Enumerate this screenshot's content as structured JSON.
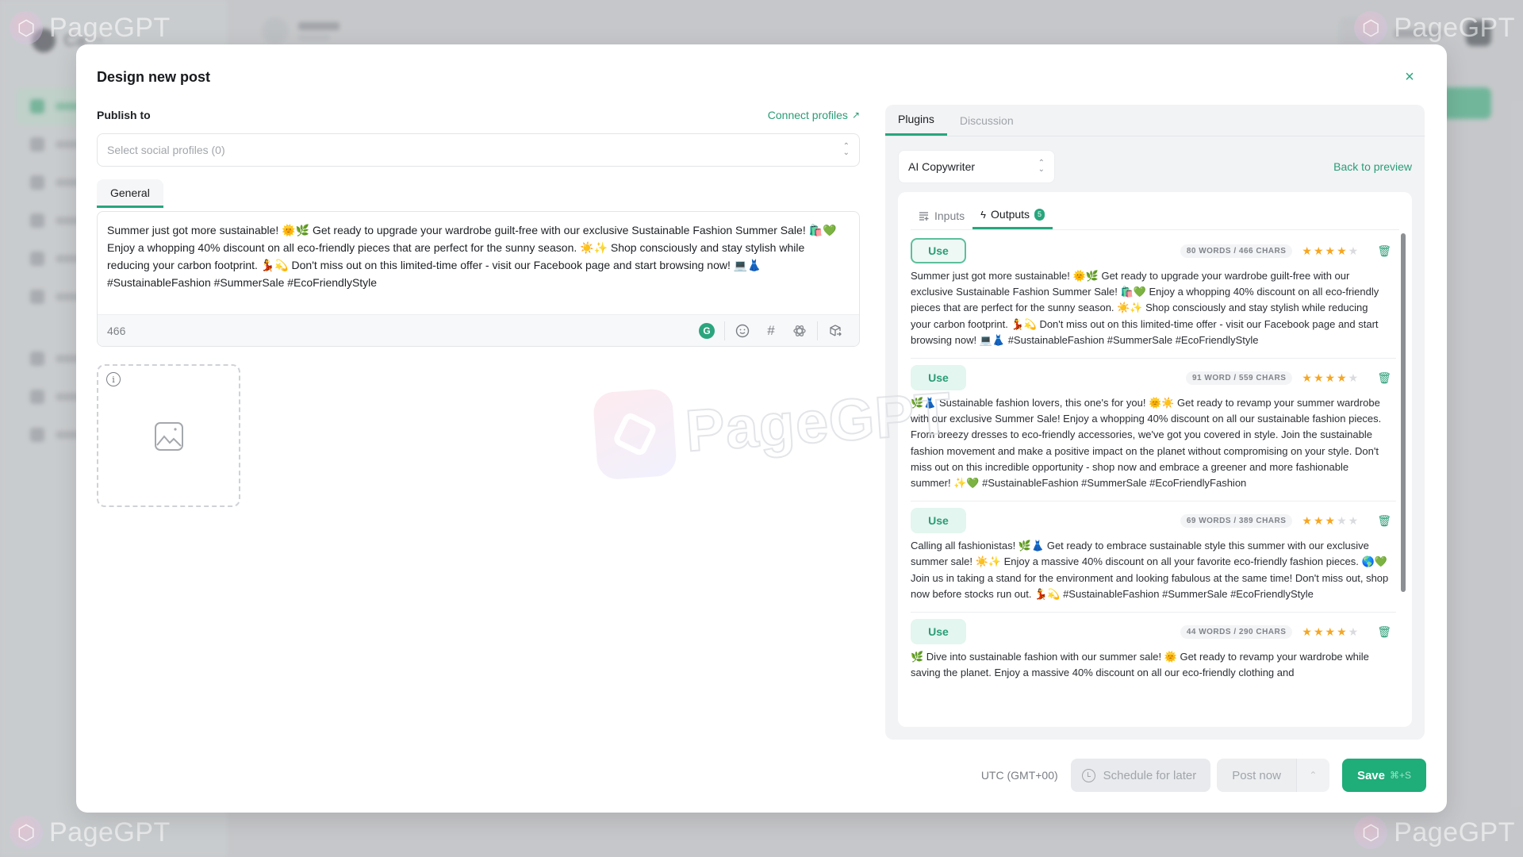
{
  "background": {
    "brand": "PageGPT",
    "workspace": "Personal"
  },
  "modal": {
    "title": "Design new post",
    "close_label": "×"
  },
  "publish": {
    "label": "Publish to",
    "connect_label": "Connect profiles",
    "select_placeholder": "Select social profiles (0)"
  },
  "editor": {
    "tab_label": "General",
    "content": "Summer just got more sustainable! 🌞🌿 Get ready to upgrade your wardrobe guilt-free with our exclusive Sustainable Fashion Summer Sale! 🛍️💚 Enjoy a whopping 40% discount on all eco-friendly pieces that are perfect for the sunny season. ☀️✨ Shop consciously and stay stylish while reducing your carbon footprint. 💃💫 Don't miss out on this limited-time offer - visit our Facebook page and start browsing now! 💻👗 #SustainableFashion #SummerSale #EcoFriendlyStyle",
    "char_count": "466",
    "tools": [
      "grammarly-icon",
      "emoji-icon",
      "hashtag-icon",
      "openai-icon",
      "export-box-icon"
    ]
  },
  "right_panel": {
    "tabs": [
      {
        "label": "Plugins",
        "active": true
      },
      {
        "label": "Discussion",
        "active": false
      }
    ],
    "plugin_selected": "AI Copywriter",
    "back_label": "Back to preview",
    "sub_tabs": [
      {
        "label": "Inputs",
        "active": false
      },
      {
        "label": "Outputs",
        "active": true,
        "badge": "5"
      }
    ],
    "use_label": "Use",
    "outputs": [
      {
        "counts": "80 WORDS / 466 CHARS",
        "rating": 4,
        "text": "Summer just got more sustainable! 🌞🌿 Get ready to upgrade your wardrobe guilt-free with our exclusive Sustainable Fashion Summer Sale! 🛍️💚 Enjoy a whopping 40% discount on all eco-friendly pieces that are perfect for the sunny season. ☀️✨ Shop consciously and stay stylish while reducing your carbon footprint. 💃💫 Don't miss out on this limited-time offer - visit our Facebook page and start browsing now! 💻👗 #SustainableFashion #SummerSale #EcoFriendlyStyle"
      },
      {
        "counts": "91 WORD / 559 CHARS",
        "rating": 4,
        "text": "🌿👗 Sustainable fashion lovers, this one's for you! 🌞☀️ Get ready to revamp your summer wardrobe with our exclusive Summer Sale! Enjoy a whopping 40% discount on all our sustainable fashion pieces. From breezy dresses to eco-friendly accessories, we've got you covered in style. Join the sustainable fashion movement and make a positive impact on the planet without compromising on your style. Don't miss out on this incredible opportunity - shop now and embrace a greener and more fashionable summer! ✨💚 #SustainableFashion #SummerSale #EcoFriendlyFashion"
      },
      {
        "counts": "69 WORDS / 389 CHARS",
        "rating": 3,
        "text": "Calling all fashionistas! 🌿👗 Get ready to embrace sustainable style this summer with our exclusive summer sale! ☀️✨ Enjoy a massive 40% discount on all your favorite eco-friendly fashion pieces. 🌎💚 Join us in taking a stand for the environment and looking fabulous at the same time! Don't miss out, shop now before stocks run out. 💃💫 #SustainableFashion #SummerSale #EcoFriendlyStyle"
      },
      {
        "counts": "44 WORDS / 290 CHARS",
        "rating": 4,
        "text": "🌿 Dive into sustainable fashion with our summer sale! 🌞 Get ready to revamp your wardrobe while saving the planet. Enjoy a massive 40% discount on all our eco-friendly clothing and"
      }
    ]
  },
  "footer": {
    "timezone": "UTC (GMT+00)",
    "schedule_label": "Schedule for later",
    "post_label": "Post now",
    "save_label": "Save",
    "save_shortcut": "⌘+S"
  },
  "colors": {
    "accent": "#27a67d",
    "save_bg": "#1fad7a",
    "star": "#f5a623"
  }
}
